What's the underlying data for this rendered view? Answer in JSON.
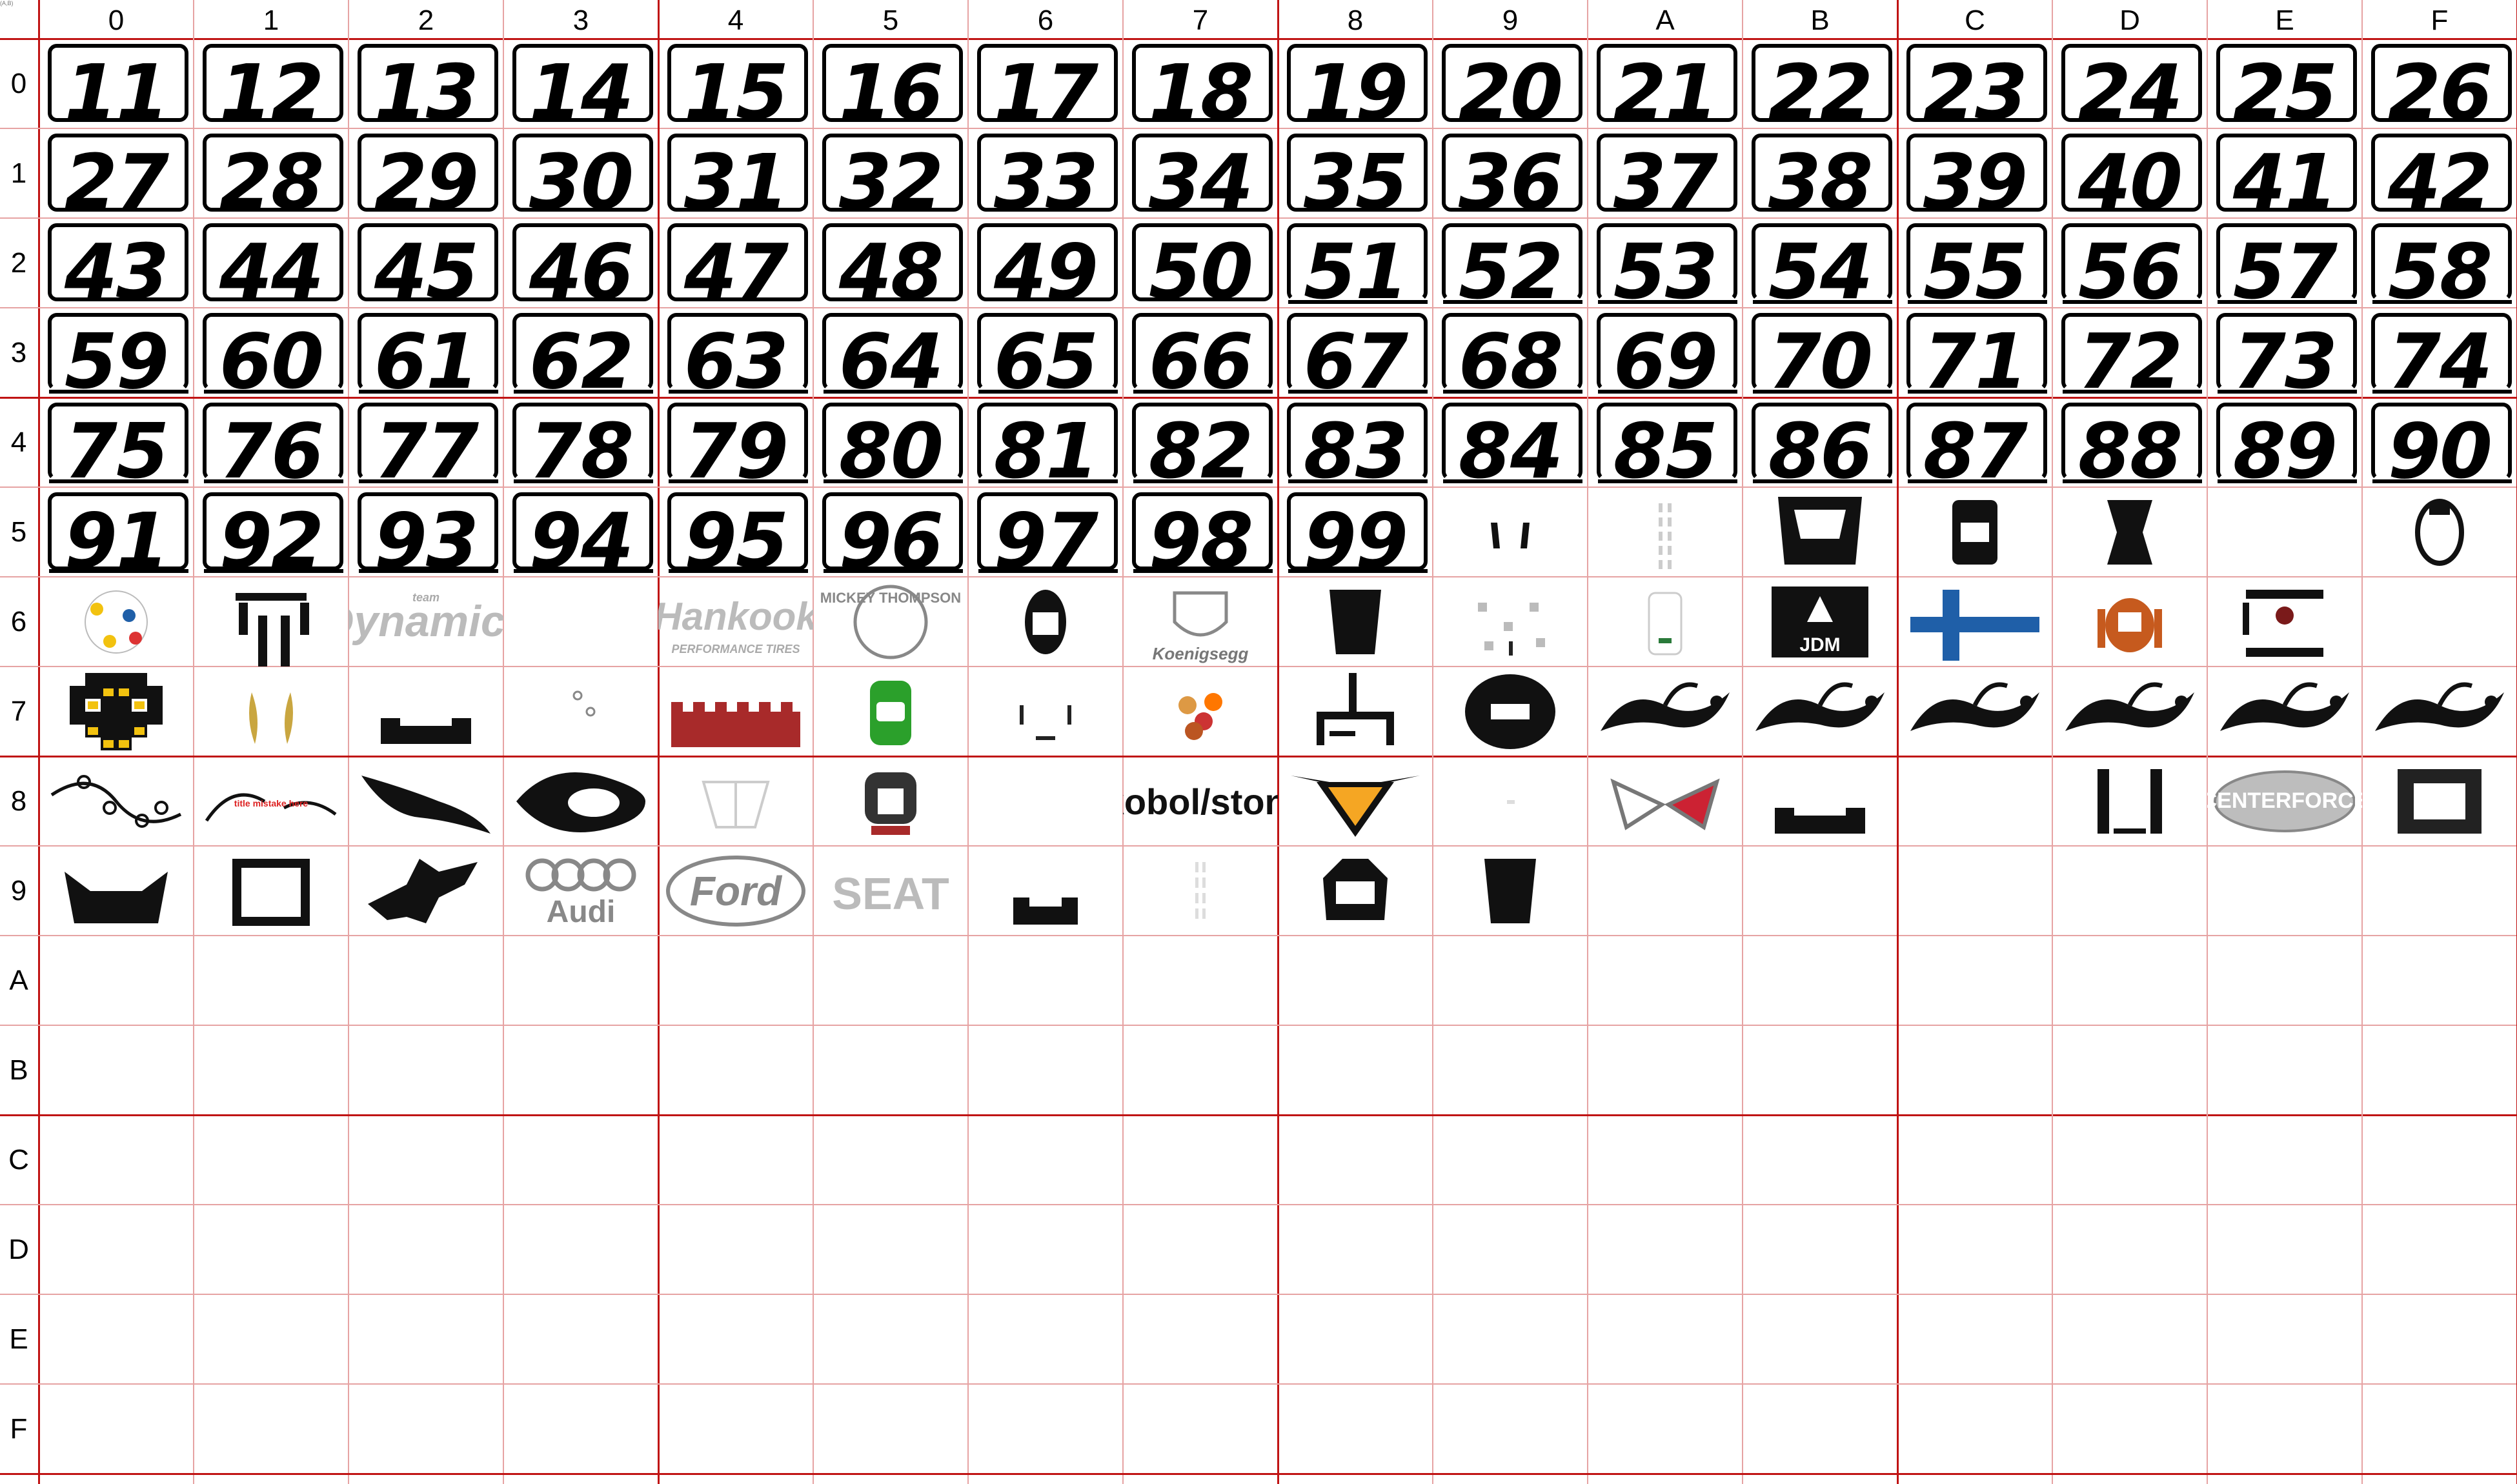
{
  "corner_label": "(A,B)",
  "columns": [
    "0",
    "1",
    "2",
    "3",
    "4",
    "5",
    "6",
    "7",
    "8",
    "9",
    "A",
    "B",
    "C",
    "D",
    "E",
    "F"
  ],
  "rows": [
    "0",
    "1",
    "2",
    "3",
    "4",
    "5",
    "6",
    "7",
    "8",
    "9",
    "A",
    "B",
    "C",
    "D",
    "E",
    "F"
  ],
  "number_decals": [
    "11",
    "12",
    "13",
    "14",
    "15",
    "16",
    "17",
    "18",
    "19",
    "20",
    "21",
    "22",
    "23",
    "24",
    "25",
    "26",
    "27",
    "28",
    "29",
    "30",
    "31",
    "32",
    "33",
    "34",
    "35",
    "36",
    "37",
    "38",
    "39",
    "40",
    "41",
    "42",
    "43",
    "44",
    "45",
    "46",
    "47",
    "48",
    "49",
    "50",
    "51",
    "52",
    "53",
    "54",
    "55",
    "56",
    "57",
    "58",
    "59",
    "60",
    "61",
    "62",
    "63",
    "64",
    "65",
    "66",
    "67",
    "68",
    "69",
    "70",
    "71",
    "72",
    "73",
    "74",
    "75",
    "76",
    "77",
    "78",
    "79",
    "80",
    "81",
    "82",
    "83",
    "84",
    "85",
    "86",
    "87",
    "88",
    "89",
    "90",
    "91",
    "92",
    "93",
    "94",
    "95",
    "96",
    "97",
    "98",
    "99"
  ],
  "image_decals": [
    {
      "row": 5,
      "col": 9,
      "icon": "small-brackets-icon"
    },
    {
      "row": 5,
      "col": 10,
      "icon": "faint-stripes-icon"
    },
    {
      "row": 5,
      "col": 11,
      "icon": "hood-scoop-icon"
    },
    {
      "row": 5,
      "col": 12,
      "icon": "car-top-icon"
    },
    {
      "row": 5,
      "col": 13,
      "icon": "spoiler-piece-icon"
    },
    {
      "row": 5,
      "col": 15,
      "icon": "car-top-outline-icon"
    },
    {
      "row": 6,
      "col": 0,
      "icon": "colorful-sketch-icon"
    },
    {
      "row": 6,
      "col": 1,
      "icon": "stripe-bars-icon"
    },
    {
      "row": 6,
      "col": 2,
      "icon": "team-dynamics-logo",
      "text": "Dynamics",
      "subtext": "team"
    },
    {
      "row": 6,
      "col": 4,
      "icon": "hankook-logo",
      "text": "Hankook",
      "subtext": "PERFORMANCE TIRES"
    },
    {
      "row": 6,
      "col": 5,
      "icon": "mickey-thompson-logo",
      "text": "MICKEY THOMPSON"
    },
    {
      "row": 6,
      "col": 6,
      "icon": "car-top-dark-icon"
    },
    {
      "row": 6,
      "col": 7,
      "icon": "koenigsegg-logo",
      "text": "Koenigsegg"
    },
    {
      "row": 6,
      "col": 8,
      "icon": "hood-panel-icon"
    },
    {
      "row": 6,
      "col": 9,
      "icon": "scattered-parts-icon"
    },
    {
      "row": 6,
      "col": 10,
      "icon": "faint-car-icon"
    },
    {
      "row": 6,
      "col": 11,
      "icon": "jdm-stickers-icon",
      "text": "JDM"
    },
    {
      "row": 6,
      "col": 12,
      "icon": "finland-flag-icon"
    },
    {
      "row": 6,
      "col": 13,
      "icon": "orange-car-icon"
    },
    {
      "row": 6,
      "col": 14,
      "icon": "black-red-parts-icon"
    },
    {
      "row": 7,
      "col": 0,
      "icon": "yellow-pixel-face-icon"
    },
    {
      "row": 7,
      "col": 1,
      "icon": "feathers-icon"
    },
    {
      "row": 7,
      "col": 2,
      "icon": "bumper-piece-icon"
    },
    {
      "row": 7,
      "col": 3,
      "icon": "tiny-marks-icon"
    },
    {
      "row": 7,
      "col": 4,
      "icon": "red-castle-icon"
    },
    {
      "row": 7,
      "col": 5,
      "icon": "green-car-icon"
    },
    {
      "row": 7,
      "col": 6,
      "icon": "faint-brackets-icon"
    },
    {
      "row": 7,
      "col": 7,
      "icon": "flower-art-icon"
    },
    {
      "row": 7,
      "col": 8,
      "icon": "rollcage-icon"
    },
    {
      "row": 7,
      "col": 9,
      "icon": "flame-grille-icon"
    },
    {
      "row": 7,
      "col": 10,
      "icon": "tribal-swirl-icon"
    },
    {
      "row": 7,
      "col": 11,
      "icon": "tribal-swirl-icon"
    },
    {
      "row": 7,
      "col": 12,
      "icon": "tribal-swirl-icon"
    },
    {
      "row": 7,
      "col": 13,
      "icon": "tribal-swirl-icon"
    },
    {
      "row": 7,
      "col": 14,
      "icon": "tribal-swirl-icon"
    },
    {
      "row": 7,
      "col": 15,
      "icon": "tribal-swirl-icon"
    },
    {
      "row": 8,
      "col": 0,
      "icon": "floral-vine-icon"
    },
    {
      "row": 8,
      "col": 1,
      "icon": "floral-vine-text-icon",
      "text": "title mistake here"
    },
    {
      "row": 8,
      "col": 2,
      "icon": "tribal-blade-icon"
    },
    {
      "row": 8,
      "col": 3,
      "icon": "tribal-flame-icon"
    },
    {
      "row": 8,
      "col": 4,
      "icon": "faint-sketch-icon"
    },
    {
      "row": 8,
      "col": 5,
      "icon": "skull-art-icon"
    },
    {
      "row": 8,
      "col": 7,
      "icon": "kobol-text-logo",
      "text": "kobol/stoni"
    },
    {
      "row": 8,
      "col": 8,
      "icon": "winged-arrow-icon"
    },
    {
      "row": 8,
      "col": 9,
      "icon": "tiny-mark-icon"
    },
    {
      "row": 8,
      "col": 10,
      "icon": "corvette-logo"
    },
    {
      "row": 8,
      "col": 11,
      "icon": "bumper-piece-icon"
    },
    {
      "row": 8,
      "col": 13,
      "icon": "door-bars-icon"
    },
    {
      "row": 8,
      "col": 14,
      "icon": "centerforce-logo",
      "text": "CENTERFORCE"
    },
    {
      "row": 8,
      "col": 15,
      "icon": "body-frame-icon"
    },
    {
      "row": 9,
      "col": 0,
      "icon": "black-bumper-icon"
    },
    {
      "row": 9,
      "col": 1,
      "icon": "corner-brackets-icon"
    },
    {
      "row": 9,
      "col": 2,
      "icon": "black-splat-icon"
    },
    {
      "row": 9,
      "col": 3,
      "icon": "audi-logo",
      "text": "Audi"
    },
    {
      "row": 9,
      "col": 4,
      "icon": "ford-logo",
      "text": "Ford"
    },
    {
      "row": 9,
      "col": 5,
      "icon": "seat-logo",
      "text": "SEAT"
    },
    {
      "row": 9,
      "col": 6,
      "icon": "bumper-badge-icon"
    },
    {
      "row": 9,
      "col": 7,
      "icon": "faint-lines-icon"
    },
    {
      "row": 9,
      "col": 8,
      "icon": "car-front-icon"
    },
    {
      "row": 9,
      "col": 9,
      "icon": "hood-panel-icon"
    }
  ],
  "colors": {
    "grid_minor": "#e6a3a3",
    "grid_major": "#c01414",
    "accent_orange": "#f5a623",
    "finland_blue": "#1f5fa8",
    "green": "#2ba02b",
    "yellow": "#f2c20f",
    "red": "#a82a2a"
  }
}
